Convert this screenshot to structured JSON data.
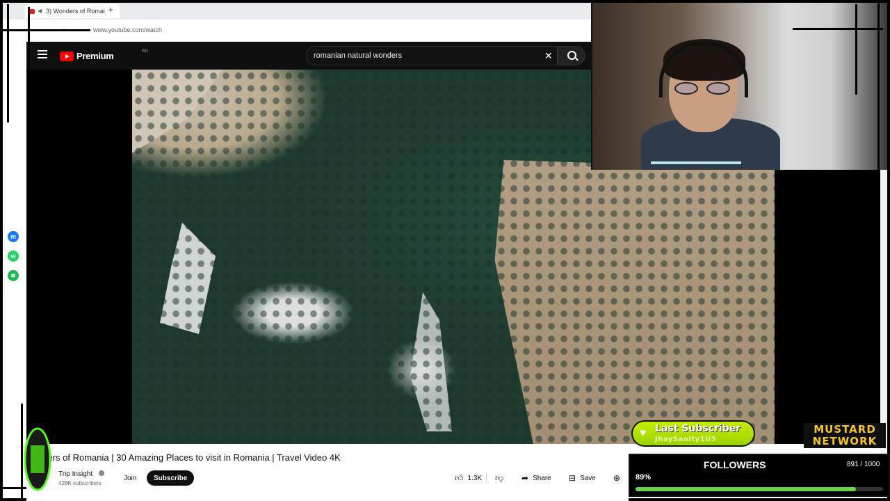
{
  "browser": {
    "tab_title": "3) Wonders of Romai",
    "new_tab_symbol": "+",
    "address": "www.youtube.com/watch"
  },
  "youtube": {
    "logo_text": "Premium",
    "country_code": "RO",
    "search_value": "romanian natural wonders",
    "clear_symbol": "✕"
  },
  "video": {
    "title": "nders of Romania | 30 Amazing Places to visit in Romania | Travel Video 4K",
    "channel_name": "Trip Insight",
    "subscribers": "428K subscribers",
    "join_label": "Join",
    "subscribe_label": "Subscribe",
    "likes": "1.3K",
    "share_label": "Share",
    "save_label": "Save"
  },
  "overlay": {
    "last_subscriber_label": "Last Subscriber",
    "last_subscriber_name": "JhaySanity1U5",
    "followers_label": "FOLLOWERS",
    "followers_count": "891 / 1000",
    "followers_percent_label": "89%",
    "followers_progress": 0.891,
    "network_line1": "MUSTARD",
    "network_line2": "NETWORK"
  },
  "colors": {
    "youtube_red": "#ff0000",
    "subscriber_green": "#b4e600",
    "progress_green": "#66d34a",
    "mustard": "#f3c52a"
  },
  "icons": {
    "messenger": "messenger-icon",
    "whatsapp": "whatsapp-icon",
    "spotify": "spotify-icon",
    "heart": "heart-icon",
    "like": "thumbs-up-icon",
    "dislike": "thumbs-down-icon",
    "share": "share-icon",
    "save": "save-icon",
    "search": "search-icon",
    "menu": "menu-icon"
  }
}
